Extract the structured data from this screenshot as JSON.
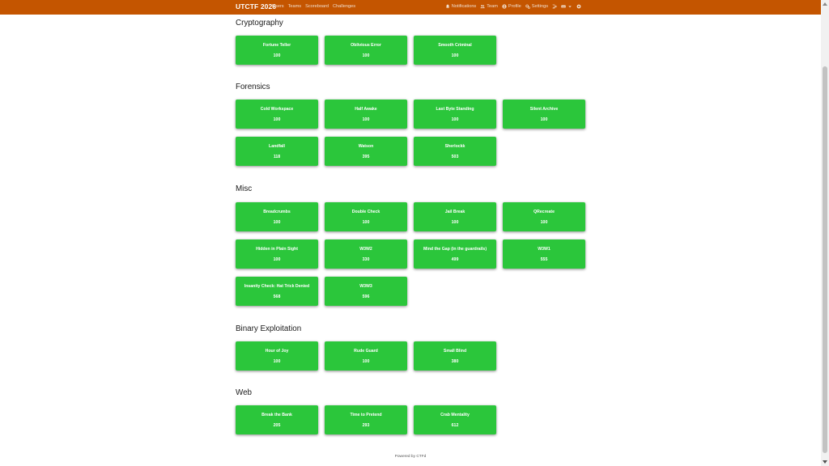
{
  "navbar": {
    "brand": "UTCTF 2026",
    "left_links": [
      "Users",
      "Teams",
      "Scoreboard",
      "Challenges"
    ],
    "right_links": [
      {
        "label": "Notifications",
        "icon": "bell-icon"
      },
      {
        "label": "Team",
        "icon": "users-icon"
      },
      {
        "label": "Profile",
        "icon": "user-circle-icon"
      },
      {
        "label": "Settings",
        "icon": "gears-icon"
      }
    ],
    "bg_color": "#c45500"
  },
  "categories": [
    {
      "name": "Cryptography",
      "challenges": [
        {
          "name": "Fortune Teller",
          "value": "100"
        },
        {
          "name": "Oblivious Error",
          "value": "100"
        },
        {
          "name": "Smooth Criminal",
          "value": "100"
        }
      ]
    },
    {
      "name": "Forensics",
      "challenges": [
        {
          "name": "Cold Workspace",
          "value": "100"
        },
        {
          "name": "Half Awake",
          "value": "100"
        },
        {
          "name": "Last Byte Standing",
          "value": "100"
        },
        {
          "name": "Silent Archive",
          "value": "100"
        },
        {
          "name": "Landfall",
          "value": "118"
        },
        {
          "name": "Watson",
          "value": "395"
        },
        {
          "name": "Sherlockk",
          "value": "503"
        }
      ]
    },
    {
      "name": "Misc",
      "challenges": [
        {
          "name": "Breadcrumbs",
          "value": "100"
        },
        {
          "name": "Double Check",
          "value": "100"
        },
        {
          "name": "Jail Break",
          "value": "100"
        },
        {
          "name": "QRecreate",
          "value": "100"
        },
        {
          "name": "Hidden in Plain Sight",
          "value": "100"
        },
        {
          "name": "W3W2",
          "value": "330"
        },
        {
          "name": "Mind the Gap (in the guardrails)",
          "value": "499"
        },
        {
          "name": "W3W1",
          "value": "555"
        },
        {
          "name": "Insanity Check: Hat Trick Denied",
          "value": "568"
        },
        {
          "name": "W3W3",
          "value": "596"
        }
      ]
    },
    {
      "name": "Binary Exploitation",
      "challenges": [
        {
          "name": "Hour of Joy",
          "value": "100"
        },
        {
          "name": "Rude Guard",
          "value": "100"
        },
        {
          "name": "Small Blind",
          "value": "380"
        }
      ]
    },
    {
      "name": "Web",
      "challenges": [
        {
          "name": "Break the Bank",
          "value": "205"
        },
        {
          "name": "Time to Pretend",
          "value": "293"
        },
        {
          "name": "Crab Mentality",
          "value": "612"
        }
      ]
    }
  ],
  "card_color": "#2bc63b",
  "footer": "Powered by CTFd"
}
